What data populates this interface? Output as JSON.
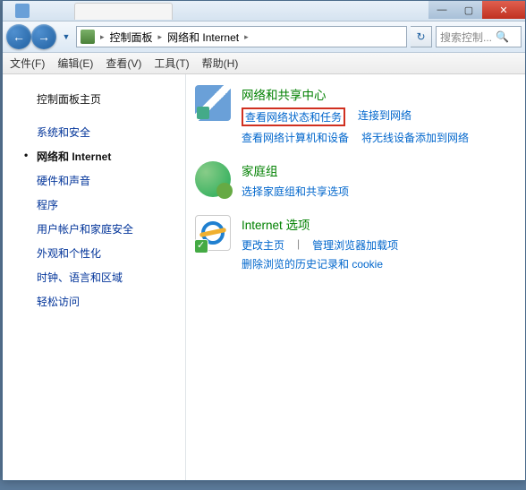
{
  "window": {
    "min": "—",
    "max": "▢",
    "close": "✕"
  },
  "nav": {
    "back": "←",
    "forward": "→",
    "refresh": "↻",
    "dropdown": "▼"
  },
  "breadcrumb": {
    "root": "控制面板",
    "current": "网络和 Internet",
    "sep": "▸"
  },
  "search": {
    "placeholder": "搜索控制...",
    "icon": "🔍"
  },
  "menu": {
    "file": "文件(F)",
    "edit": "编辑(E)",
    "view": "查看(V)",
    "tools": "工具(T)",
    "help": "帮助(H)"
  },
  "sidebar": {
    "home": "控制面板主页",
    "items": [
      "系统和安全",
      "网络和 Internet",
      "硬件和声音",
      "程序",
      "用户帐户和家庭安全",
      "外观和个性化",
      "时钟、语言和区域",
      "轻松访问"
    ],
    "active_index": 1
  },
  "sections": {
    "network": {
      "title": "网络和共享中心",
      "links": {
        "status": "查看网络状态和任务",
        "connect": "连接到网络",
        "computers": "查看网络计算机和设备",
        "wireless": "将无线设备添加到网络"
      }
    },
    "homegroup": {
      "title": "家庭组",
      "links": {
        "choose": "选择家庭组和共享选项"
      }
    },
    "internet": {
      "title": "Internet 选项",
      "links": {
        "homepage": "更改主页",
        "addons": "管理浏览器加载项",
        "history": "删除浏览的历史记录和 cookie"
      }
    }
  }
}
